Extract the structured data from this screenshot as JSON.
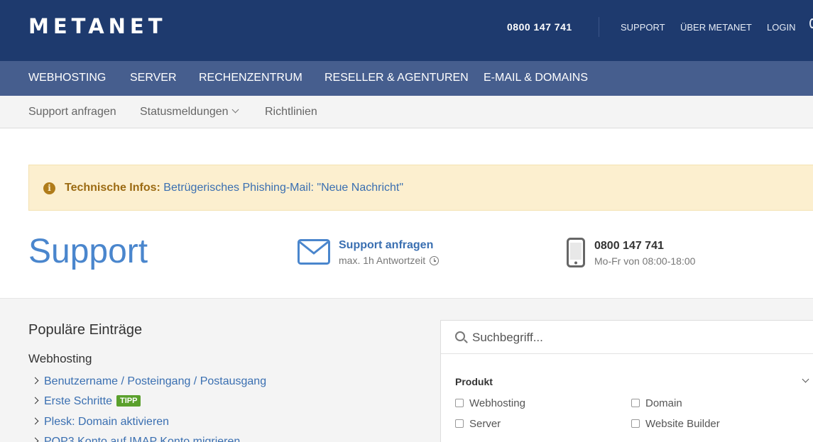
{
  "header": {
    "logo": "METANET",
    "phone": "0800 147 741",
    "links": {
      "support": "SUPPORT",
      "ueber": "ÜBER METANET",
      "login": "LOGIN"
    }
  },
  "mainnav": [
    "WEBHOSTING",
    "SERVER",
    "RECHENZENTRUM",
    "RESELLER & AGENTUREN",
    "E-MAIL & DOMAINS"
  ],
  "subnav": {
    "support": "Support anfragen",
    "status": "Statusmeldungen",
    "richtlinien": "Richtlinien"
  },
  "alert": {
    "label": "Technische Infos:",
    "link": "Betrügerisches Phishing-Mail: \"Neue Nachricht\""
  },
  "hero": {
    "title": "Support",
    "contact": {
      "title": "Support anfragen",
      "subtitle": "max. 1h Antwortzeit"
    },
    "phone": {
      "number": "0800 147 741",
      "hours": "Mo-Fr von 08:00-18:00"
    }
  },
  "popular": {
    "title": "Populäre Einträge",
    "category": "Webhosting",
    "items": [
      {
        "label": "Benutzername / Posteingang / Postausgang"
      },
      {
        "label": "Erste Schritte",
        "badge": "TIPP"
      },
      {
        "label": "Plesk: Domain aktivieren"
      },
      {
        "label": "POP3 Konto auf IMAP Konto migrieren"
      }
    ]
  },
  "search": {
    "placeholder": "Suchbegriff...",
    "filter_title": "Produkt",
    "options": [
      "Webhosting",
      "Domain",
      "Server",
      "Website Builder"
    ]
  },
  "colors": {
    "header_bg": "#1e3a6e",
    "nav_bg": "#465e8e",
    "alert_bg": "#fcefcf",
    "link": "#3a6fb1",
    "accent": "#4a86cd",
    "tipp_badge": "#5aa02c"
  }
}
